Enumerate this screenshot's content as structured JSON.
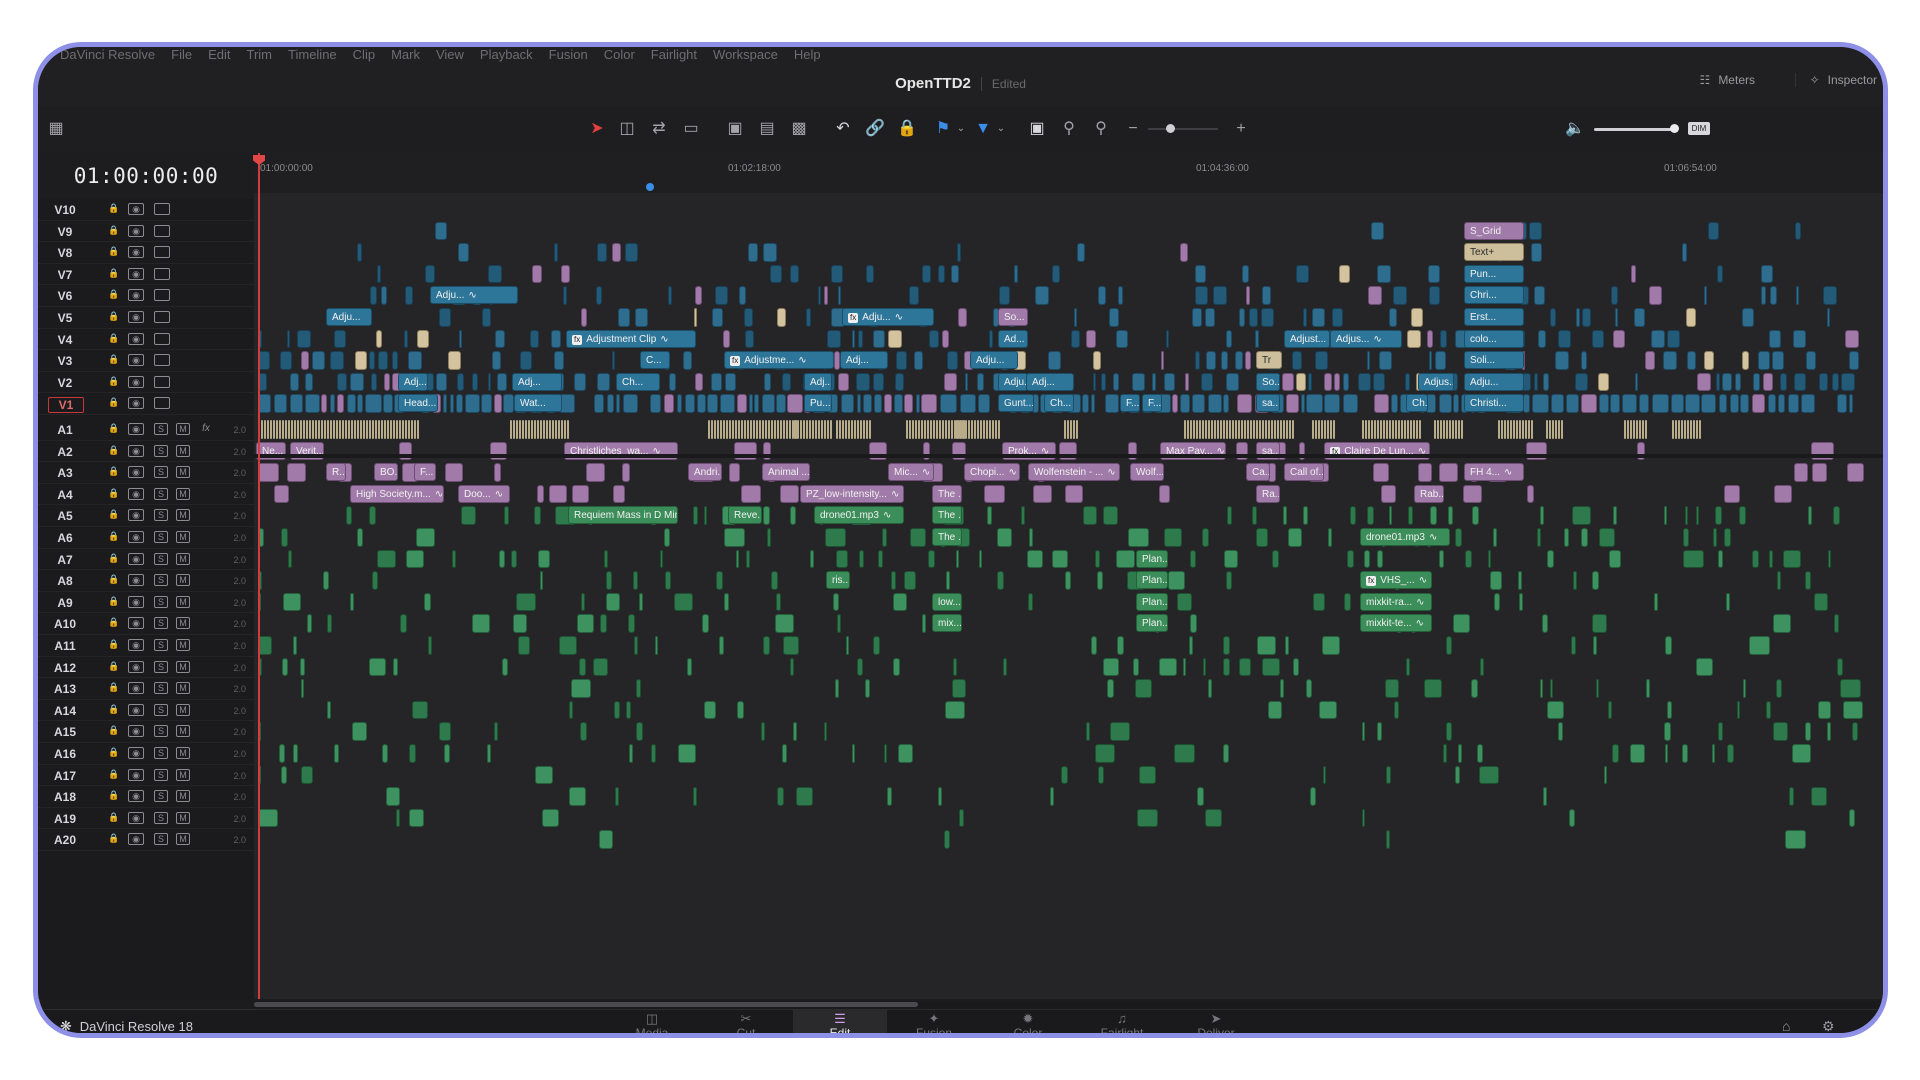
{
  "menubar": {
    "app_menu": "DaVinci Resolve",
    "menus": [
      "File",
      "Edit",
      "Trim",
      "Timeline",
      "Clip",
      "Mark",
      "View",
      "Playback",
      "Fusion",
      "Color",
      "Fairlight",
      "Workspace",
      "Help"
    ],
    "project_title": "OpenTTD2",
    "project_status": "Edited",
    "meters_label": "Meters",
    "inspector_label": "Inspector"
  },
  "timecode": "01:00:00:00",
  "ruler": {
    "labels": [
      "01:00:00:00",
      "01:02:18:00",
      "01:04:36:00",
      "01:06:54:00"
    ]
  },
  "video_tracks": [
    "V10",
    "V9",
    "V8",
    "V7",
    "V6",
    "V5",
    "V4",
    "V3",
    "V2",
    "V1"
  ],
  "audio_tracks": [
    "A1",
    "A2",
    "A3",
    "A4",
    "A5",
    "A6",
    "A7",
    "A8",
    "A9",
    "A10",
    "A11",
    "A12",
    "A13",
    "A14",
    "A15",
    "A16",
    "A17",
    "A18",
    "A19",
    "A20"
  ],
  "audio_channel_label": "2.0",
  "clip_labels": {
    "v9_grid": "S_Grid",
    "v8_text": "Text+",
    "v7_pun": "Pun...",
    "v6_adj": "Adju...",
    "v6_chri": "Chri...",
    "v5_adj1": "Adju...",
    "v5_adj2": "Adju...",
    "v5_so": "So...",
    "v5_erst": "Erst...",
    "v4_adjclip": "Adjustment Clip",
    "v4_ad": "Ad...",
    "v4_adjust": "Adjust...",
    "v4_adjus": "Adjus...",
    "v4_colo": "colo...",
    "v3_c": "C...",
    "v3_adjustme": "Adjustme...",
    "v3_adj": "Adj...",
    "v3_adju": "Adju...",
    "v3_tr": "Tr",
    "v3_soli": "Soli...",
    "v2_adj1": "Adj...",
    "v2_adj2": "Adj...",
    "v2_ch": "Ch...",
    "v2_adj3": "Adj...",
    "v2_adju": "Adju...",
    "v2_adj4": "Adj...",
    "v2_so": "So...",
    "v2_adjus": "Adjus...",
    "v2_adju2": "Adju...",
    "v1_head": "Head...",
    "v1_wat": "Wat...",
    "v1_pu": "Pu...",
    "v1_gunt": "Gunt...",
    "v1_ch": "Ch...",
    "v1_f1": "F...",
    "v1_f2": "F...",
    "v1_sa": "sa...",
    "v1_ch2": "Ch...",
    "v1_christi": "Christi...",
    "a2_ne": "Ne...",
    "a2_verit": "Verit...",
    "a2_christ": "Christliches_wa...",
    "a2_prok": "Prok...",
    "a2_maxpay": "Max Pay...",
    "a2_sa": "sa...",
    "a2_claire": "Claire De Lun...",
    "a3_r": "R...",
    "a3_bo": "BO...",
    "a3_f": "F...",
    "a3_andri": "Andri...",
    "a3_animal": "Animal ...",
    "a3_mic": "Mic...",
    "a3_chopi": "Chopi...",
    "a3_wolfenstein": "Wolfenstein - ...",
    "a3_wolf": "Wolf...",
    "a3_ca": "Ca...",
    "a3_callof": "Call of...",
    "a3_fh4": "FH 4...",
    "a4_highsociety": "High Society.m...",
    "a4_doo": "Doo...",
    "a4_pz": "PZ_low-intensity...",
    "a4_the": "The ...",
    "a4_ra": "Ra...",
    "a4_rab": "Rab...",
    "a5_requiem": "Requiem Mass in D Min...",
    "a5_reve": "Reve...",
    "a5_drone": "drone01.mp3",
    "a5_the": "The ...",
    "a6_the": "The ...",
    "a6_drone": "drone01.mp3",
    "a7_plan": "Plan...",
    "a8_ris": "ris...",
    "a8_plan": "Plan...",
    "a8_vhs": "VHS_...",
    "a9_low": "low...",
    "a9_plan": "Plan...",
    "a9_mixkit": "mixkit-ra...",
    "a10_mix": "mix...",
    "a10_plan": "Plan...",
    "a10_mixkit": "mixkit-te..."
  },
  "footer": {
    "brand": "DaVinci Resolve 18",
    "pages": [
      "Media",
      "Cut",
      "Edit",
      "Fusion",
      "Color",
      "Fairlight",
      "Deliver"
    ],
    "active_page": "Edit"
  },
  "colors": {
    "frame_border": "#8e8fe6",
    "video_clip": "#2f6d8f",
    "adjustment_clip": "#a27aa9",
    "audio_clip": "#2f7a4c",
    "playhead": "#d23c3c"
  }
}
